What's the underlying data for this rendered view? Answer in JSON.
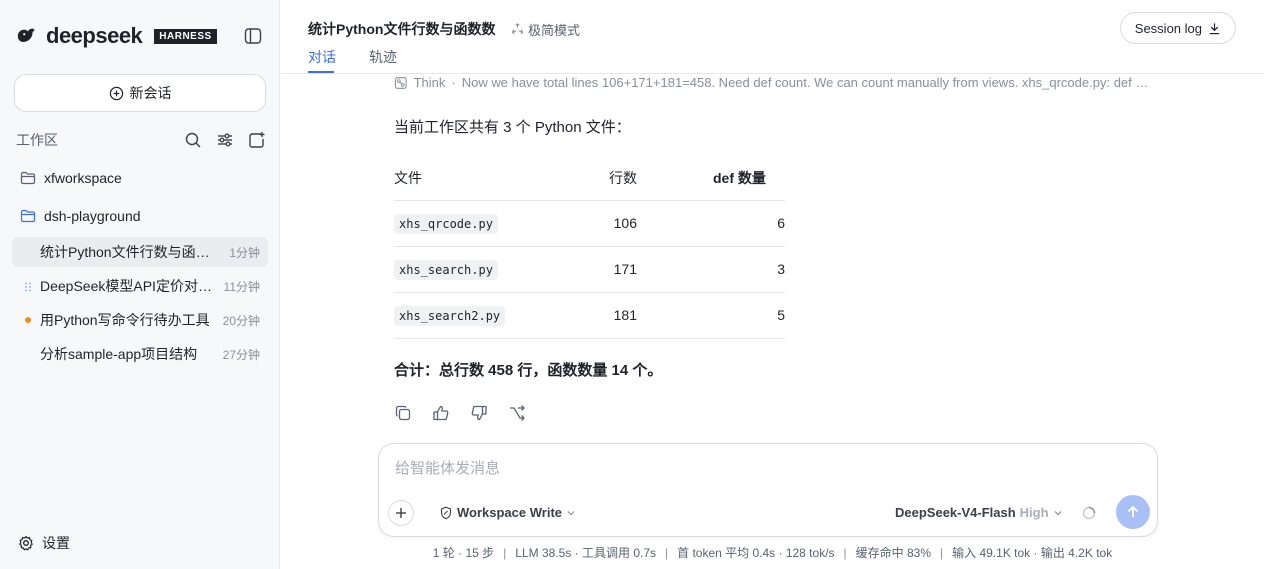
{
  "sidebar": {
    "logo_text": "deepseek",
    "logo_badge": "HARNESS",
    "new_chat_label": "新会话",
    "workspace_title": "工作区",
    "folders": [
      {
        "label": "xfworkspace"
      },
      {
        "label": "dsh-playground"
      }
    ],
    "chats": [
      {
        "label": "统计Python文件行数与函数数",
        "time": "1分钟"
      },
      {
        "label": "DeepSeek模型API定价对比...",
        "time": "11分钟"
      },
      {
        "label": "用Python写命令行待办工具",
        "time": "20分钟"
      },
      {
        "label": "分析sample-app项目结构",
        "time": "27分钟"
      }
    ],
    "settings_label": "设置"
  },
  "header": {
    "title": "统计Python文件行数与函数数",
    "mode": "极简模式",
    "session_log": "Session log",
    "tabs": [
      {
        "label": "对话"
      },
      {
        "label": "轨迹"
      }
    ]
  },
  "message": {
    "think_label": "Think",
    "think_text": "Now we have total lines 106+171+181=458. Need def count. We can count manually from views. xhs_qrcode.py: def count?",
    "intro": "当前工作区共有 3 个 Python 文件：",
    "table": {
      "headers": [
        "文件",
        "行数",
        "def 数量"
      ],
      "rows": [
        {
          "file": "xhs_qrcode.py",
          "lines": "106",
          "defs": "6"
        },
        {
          "file": "xhs_search.py",
          "lines": "171",
          "defs": "3"
        },
        {
          "file": "xhs_search2.py",
          "lines": "181",
          "defs": "5"
        }
      ]
    },
    "summary": "合计：总行数 458 行，函数数量 14 个。"
  },
  "composer": {
    "placeholder": "给智能体发消息",
    "permission": "Workspace Write",
    "model": "DeepSeek-V4-Flash",
    "level": "High"
  },
  "stats": {
    "rounds": "1 轮 · 15 步",
    "llm": "LLM 38.5s · 工具调用 0.7s",
    "token": "首 token 平均 0.4s · 128 tok/s",
    "cache": "缓存命中 83%",
    "io": "输入 49.1K tok · 输出 4.2K tok"
  },
  "colors": {
    "accent": "#3b6cf5",
    "send_button": "#a9c1f7",
    "status_dot": "#f08c1a"
  }
}
